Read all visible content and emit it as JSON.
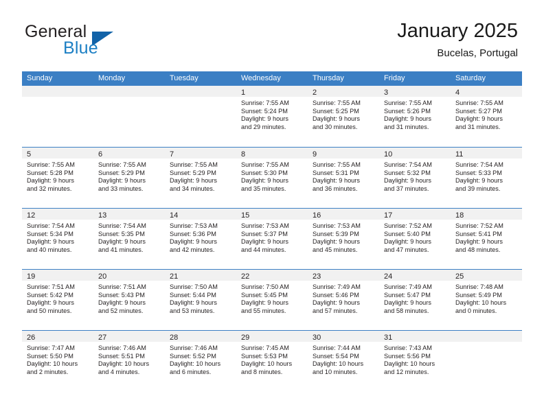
{
  "brand": {
    "name_part1": "General",
    "name_part2": "Blue",
    "triangle_icon": "triangle-icon"
  },
  "header": {
    "title": "January 2025",
    "subtitle": "Bucelas, Portugal"
  },
  "calendar": {
    "day_headers": [
      "Sunday",
      "Monday",
      "Tuesday",
      "Wednesday",
      "Thursday",
      "Friday",
      "Saturday"
    ],
    "colors": {
      "header_blue": "#3b7fc4",
      "date_band_gray": "#f1f1f1",
      "brand_blue": "#1c7fc4",
      "text": "#231f20"
    },
    "weeks": [
      [
        {
          "date": "",
          "sunrise": "",
          "sunset": "",
          "daylight_line1": "",
          "daylight_line2": "",
          "empty": true
        },
        {
          "date": "",
          "sunrise": "",
          "sunset": "",
          "daylight_line1": "",
          "daylight_line2": "",
          "empty": true
        },
        {
          "date": "",
          "sunrise": "",
          "sunset": "",
          "daylight_line1": "",
          "daylight_line2": "",
          "empty": true
        },
        {
          "date": "1",
          "sunrise": "Sunrise: 7:55 AM",
          "sunset": "Sunset: 5:24 PM",
          "daylight_line1": "Daylight: 9 hours",
          "daylight_line2": "and 29 minutes."
        },
        {
          "date": "2",
          "sunrise": "Sunrise: 7:55 AM",
          "sunset": "Sunset: 5:25 PM",
          "daylight_line1": "Daylight: 9 hours",
          "daylight_line2": "and 30 minutes."
        },
        {
          "date": "3",
          "sunrise": "Sunrise: 7:55 AM",
          "sunset": "Sunset: 5:26 PM",
          "daylight_line1": "Daylight: 9 hours",
          "daylight_line2": "and 31 minutes."
        },
        {
          "date": "4",
          "sunrise": "Sunrise: 7:55 AM",
          "sunset": "Sunset: 5:27 PM",
          "daylight_line1": "Daylight: 9 hours",
          "daylight_line2": "and 31 minutes."
        }
      ],
      [
        {
          "date": "5",
          "sunrise": "Sunrise: 7:55 AM",
          "sunset": "Sunset: 5:28 PM",
          "daylight_line1": "Daylight: 9 hours",
          "daylight_line2": "and 32 minutes."
        },
        {
          "date": "6",
          "sunrise": "Sunrise: 7:55 AM",
          "sunset": "Sunset: 5:29 PM",
          "daylight_line1": "Daylight: 9 hours",
          "daylight_line2": "and 33 minutes."
        },
        {
          "date": "7",
          "sunrise": "Sunrise: 7:55 AM",
          "sunset": "Sunset: 5:29 PM",
          "daylight_line1": "Daylight: 9 hours",
          "daylight_line2": "and 34 minutes."
        },
        {
          "date": "8",
          "sunrise": "Sunrise: 7:55 AM",
          "sunset": "Sunset: 5:30 PM",
          "daylight_line1": "Daylight: 9 hours",
          "daylight_line2": "and 35 minutes."
        },
        {
          "date": "9",
          "sunrise": "Sunrise: 7:55 AM",
          "sunset": "Sunset: 5:31 PM",
          "daylight_line1": "Daylight: 9 hours",
          "daylight_line2": "and 36 minutes."
        },
        {
          "date": "10",
          "sunrise": "Sunrise: 7:54 AM",
          "sunset": "Sunset: 5:32 PM",
          "daylight_line1": "Daylight: 9 hours",
          "daylight_line2": "and 37 minutes."
        },
        {
          "date": "11",
          "sunrise": "Sunrise: 7:54 AM",
          "sunset": "Sunset: 5:33 PM",
          "daylight_line1": "Daylight: 9 hours",
          "daylight_line2": "and 39 minutes."
        }
      ],
      [
        {
          "date": "12",
          "sunrise": "Sunrise: 7:54 AM",
          "sunset": "Sunset: 5:34 PM",
          "daylight_line1": "Daylight: 9 hours",
          "daylight_line2": "and 40 minutes."
        },
        {
          "date": "13",
          "sunrise": "Sunrise: 7:54 AM",
          "sunset": "Sunset: 5:35 PM",
          "daylight_line1": "Daylight: 9 hours",
          "daylight_line2": "and 41 minutes."
        },
        {
          "date": "14",
          "sunrise": "Sunrise: 7:53 AM",
          "sunset": "Sunset: 5:36 PM",
          "daylight_line1": "Daylight: 9 hours",
          "daylight_line2": "and 42 minutes."
        },
        {
          "date": "15",
          "sunrise": "Sunrise: 7:53 AM",
          "sunset": "Sunset: 5:37 PM",
          "daylight_line1": "Daylight: 9 hours",
          "daylight_line2": "and 44 minutes."
        },
        {
          "date": "16",
          "sunrise": "Sunrise: 7:53 AM",
          "sunset": "Sunset: 5:39 PM",
          "daylight_line1": "Daylight: 9 hours",
          "daylight_line2": "and 45 minutes."
        },
        {
          "date": "17",
          "sunrise": "Sunrise: 7:52 AM",
          "sunset": "Sunset: 5:40 PM",
          "daylight_line1": "Daylight: 9 hours",
          "daylight_line2": "and 47 minutes."
        },
        {
          "date": "18",
          "sunrise": "Sunrise: 7:52 AM",
          "sunset": "Sunset: 5:41 PM",
          "daylight_line1": "Daylight: 9 hours",
          "daylight_line2": "and 48 minutes."
        }
      ],
      [
        {
          "date": "19",
          "sunrise": "Sunrise: 7:51 AM",
          "sunset": "Sunset: 5:42 PM",
          "daylight_line1": "Daylight: 9 hours",
          "daylight_line2": "and 50 minutes."
        },
        {
          "date": "20",
          "sunrise": "Sunrise: 7:51 AM",
          "sunset": "Sunset: 5:43 PM",
          "daylight_line1": "Daylight: 9 hours",
          "daylight_line2": "and 52 minutes."
        },
        {
          "date": "21",
          "sunrise": "Sunrise: 7:50 AM",
          "sunset": "Sunset: 5:44 PM",
          "daylight_line1": "Daylight: 9 hours",
          "daylight_line2": "and 53 minutes."
        },
        {
          "date": "22",
          "sunrise": "Sunrise: 7:50 AM",
          "sunset": "Sunset: 5:45 PM",
          "daylight_line1": "Daylight: 9 hours",
          "daylight_line2": "and 55 minutes."
        },
        {
          "date": "23",
          "sunrise": "Sunrise: 7:49 AM",
          "sunset": "Sunset: 5:46 PM",
          "daylight_line1": "Daylight: 9 hours",
          "daylight_line2": "and 57 minutes."
        },
        {
          "date": "24",
          "sunrise": "Sunrise: 7:49 AM",
          "sunset": "Sunset: 5:47 PM",
          "daylight_line1": "Daylight: 9 hours",
          "daylight_line2": "and 58 minutes."
        },
        {
          "date": "25",
          "sunrise": "Sunrise: 7:48 AM",
          "sunset": "Sunset: 5:49 PM",
          "daylight_line1": "Daylight: 10 hours",
          "daylight_line2": "and 0 minutes."
        }
      ],
      [
        {
          "date": "26",
          "sunrise": "Sunrise: 7:47 AM",
          "sunset": "Sunset: 5:50 PM",
          "daylight_line1": "Daylight: 10 hours",
          "daylight_line2": "and 2 minutes."
        },
        {
          "date": "27",
          "sunrise": "Sunrise: 7:46 AM",
          "sunset": "Sunset: 5:51 PM",
          "daylight_line1": "Daylight: 10 hours",
          "daylight_line2": "and 4 minutes."
        },
        {
          "date": "28",
          "sunrise": "Sunrise: 7:46 AM",
          "sunset": "Sunset: 5:52 PM",
          "daylight_line1": "Daylight: 10 hours",
          "daylight_line2": "and 6 minutes."
        },
        {
          "date": "29",
          "sunrise": "Sunrise: 7:45 AM",
          "sunset": "Sunset: 5:53 PM",
          "daylight_line1": "Daylight: 10 hours",
          "daylight_line2": "and 8 minutes."
        },
        {
          "date": "30",
          "sunrise": "Sunrise: 7:44 AM",
          "sunset": "Sunset: 5:54 PM",
          "daylight_line1": "Daylight: 10 hours",
          "daylight_line2": "and 10 minutes."
        },
        {
          "date": "31",
          "sunrise": "Sunrise: 7:43 AM",
          "sunset": "Sunset: 5:56 PM",
          "daylight_line1": "Daylight: 10 hours",
          "daylight_line2": "and 12 minutes."
        },
        {
          "date": "",
          "sunrise": "",
          "sunset": "",
          "daylight_line1": "",
          "daylight_line2": "",
          "empty": true
        }
      ]
    ]
  }
}
